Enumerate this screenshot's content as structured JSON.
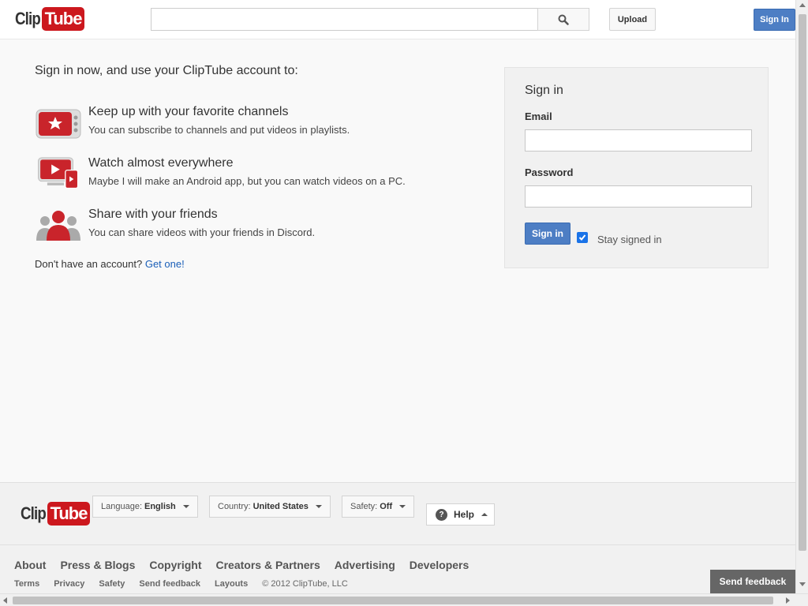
{
  "brand": {
    "clip": "Clip",
    "tube": "Tube",
    "color": "#cc181e"
  },
  "header": {
    "search_placeholder": "",
    "upload_label": "Upload",
    "signin_label": "Sign In"
  },
  "main": {
    "intro": "Sign in now, and use your ClipTube account to:",
    "features": [
      {
        "title": "Keep up with your favorite channels",
        "desc": "You can subscribe to channels and put videos in playlists.",
        "icon": "tv-star-icon"
      },
      {
        "title": "Watch almost everywhere",
        "desc": "Maybe I will make an Android app, but you can watch videos on a PC.",
        "icon": "multi-device-icon"
      },
      {
        "title": "Share with your friends",
        "desc": "You can share videos with your friends in Discord.",
        "icon": "people-icon"
      }
    ],
    "no_account_text": "Don't have an account?",
    "get_one_link": "Get one!"
  },
  "signin_panel": {
    "title": "Sign in",
    "email_label": "Email",
    "password_label": "Password",
    "email_value": "",
    "password_value": "",
    "signin_button": "Sign in",
    "stay_signed_in": "Stay signed in",
    "stay_checked": true,
    "accent": "#4d7ec4"
  },
  "footer": {
    "language_label": "Language:",
    "language_value": "English",
    "country_label": "Country:",
    "country_value": "United States",
    "safety_label": "Safety:",
    "safety_value": "Off",
    "help_label": "Help",
    "primary_links": [
      "About",
      "Press & Blogs",
      "Copyright",
      "Creators & Partners",
      "Advertising",
      "Developers"
    ],
    "secondary_links": [
      "Terms",
      "Privacy",
      "Safety",
      "Send feedback",
      "Layouts"
    ],
    "copyright": "© 2012 ClipTube, LLC",
    "send_feedback_button": "Send feedback"
  }
}
